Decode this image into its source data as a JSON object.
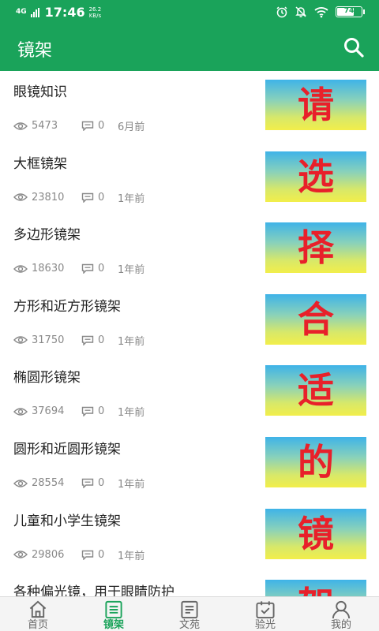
{
  "status_bar": {
    "network": "4G",
    "time": "17:46",
    "speed_value": "26.2",
    "speed_unit": "KB/s",
    "battery": "74",
    "battery_level": 0.74,
    "icons": [
      "alarm-icon",
      "mute-icon",
      "wifi-icon",
      "battery-icon"
    ]
  },
  "app_bar": {
    "title": "镜架",
    "search_icon": "search-icon"
  },
  "list": [
    {
      "title": "眼镜知识",
      "views": "5473",
      "comments": "0",
      "time": "6月前",
      "thumb_char": "请"
    },
    {
      "title": "大框镜架",
      "views": "23810",
      "comments": "0",
      "time": "1年前",
      "thumb_char": "选"
    },
    {
      "title": "多边形镜架",
      "views": "18630",
      "comments": "0",
      "time": "1年前",
      "thumb_char": "择"
    },
    {
      "title": "方形和近方形镜架",
      "views": "31750",
      "comments": "0",
      "time": "1年前",
      "thumb_char": "合"
    },
    {
      "title": "椭圆形镜架",
      "views": "37694",
      "comments": "0",
      "time": "1年前",
      "thumb_char": "适"
    },
    {
      "title": "圆形和近圆形镜架",
      "views": "28554",
      "comments": "0",
      "time": "1年前",
      "thumb_char": "的"
    },
    {
      "title": "儿童和小学生镜架",
      "views": "29806",
      "comments": "0",
      "time": "1年前",
      "thumb_char": "镜"
    },
    {
      "title": "各种偏光镜，用于眼睛防护",
      "views": "",
      "comments": "",
      "time": "",
      "thumb_char": "架"
    }
  ],
  "bottom_nav": [
    {
      "label": "首页",
      "icon": "home-icon",
      "active": false
    },
    {
      "label": "镜架",
      "icon": "list-icon",
      "active": true
    },
    {
      "label": "文苑",
      "icon": "document-icon",
      "active": false
    },
    {
      "label": "验光",
      "icon": "calendar-check-icon",
      "active": false
    },
    {
      "label": "我的",
      "icon": "user-icon",
      "active": false
    }
  ],
  "colors": {
    "primary": "#1aa35a",
    "thumb_text": "#e8202a",
    "meta_text": "#888888"
  }
}
